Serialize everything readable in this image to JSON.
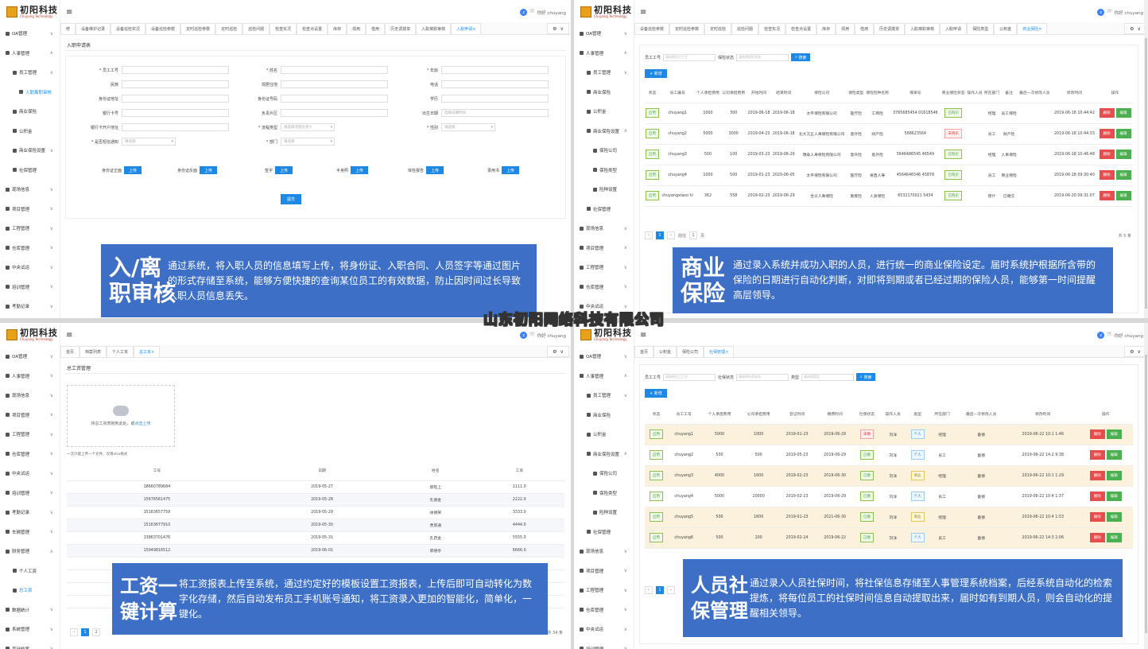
{
  "logo": {
    "cn": "初阳科技",
    "en": "Chuyang Technology"
  },
  "user": {
    "greeting": "你好 chuyang",
    "badge": "z"
  },
  "watermark": "山东初阳网络科技有限公司",
  "q1": {
    "menu": [
      {
        "label": "OA管理",
        "chev": "∨"
      },
      {
        "label": "人事管理",
        "chev": "∧"
      },
      {
        "label": "员工管理",
        "chev": "∧",
        "level": 1
      },
      {
        "label": "入职离职审核",
        "level": 2,
        "active": true
      },
      {
        "label": "商业保险",
        "level": 1
      },
      {
        "label": "公积金",
        "level": 1
      },
      {
        "label": "商业保险设置",
        "chev": "∨",
        "level": 1
      },
      {
        "label": "社保管理",
        "level": 1
      },
      {
        "label": "现场信息",
        "chev": "∨"
      },
      {
        "label": "项目管理",
        "chev": "∨"
      },
      {
        "label": "工程管理",
        "chev": "∨"
      },
      {
        "label": "仓库管理",
        "chev": "∨"
      },
      {
        "label": "中央试运",
        "chev": "∨"
      },
      {
        "label": "培训管理",
        "chev": "∨"
      },
      {
        "label": "考勤记录",
        "chev": "∨"
      },
      {
        "label": "车辆管理",
        "chev": "∨"
      }
    ],
    "tabs": [
      "修",
      "设备维护记录",
      "设备巡检实况",
      "设备巡检参数",
      "定时巡检参数",
      "定时巡检",
      "巡检问题",
      "检查实况",
      "检查点设置",
      "库存",
      "领用",
      "借用",
      "历史调拨单",
      "入职离职审核",
      "入职申请"
    ],
    "active_tab": "入职申请",
    "page_title": "入职申请表",
    "fields": [
      {
        "label": "* 员工工号",
        "col": 0,
        "row": 0
      },
      {
        "label": "* 姓名",
        "col": 1,
        "row": 0
      },
      {
        "label": "* 年龄",
        "col": 2,
        "row": 0
      },
      {
        "label": "民族",
        "col": 0,
        "row": 1
      },
      {
        "label": "现居住地",
        "col": 1,
        "row": 1
      },
      {
        "label": "电话",
        "col": 2,
        "row": 1
      },
      {
        "label": "身份证地址",
        "col": 0,
        "row": 2
      },
      {
        "label": "身份证号码",
        "col": 1,
        "row": 2
      },
      {
        "label": "学历",
        "col": 2,
        "row": 2
      },
      {
        "label": "银行卡号",
        "col": 0,
        "row": 3
      },
      {
        "label": "负责片区",
        "col": 1,
        "row": 3
      },
      {
        "label": "出生日期",
        "col": 2,
        "row": 3,
        "placeholder": "选择日期时间"
      }
    ],
    "selects": [
      {
        "label": "银行卡开户地址",
        "col": 0,
        "row": 4,
        "type": "input"
      },
      {
        "label": "* 流程类型",
        "col": 1,
        "row": 4,
        "placeholder": "请选择流程负责人"
      },
      {
        "label": "* 性别",
        "col": 2,
        "row": 4,
        "placeholder": "请选择"
      },
      {
        "label": "* 是否短信通知",
        "col": 0,
        "row": 5,
        "placeholder": "请选择"
      },
      {
        "label": "* 部门",
        "col": 1,
        "row": 5,
        "placeholder": "请选择"
      }
    ],
    "uploads": [
      "身份证正面",
      "身份证反面",
      "签字",
      "半身照",
      "体检报告",
      "录用书"
    ],
    "upload_label": "上传",
    "submit_label": "提交",
    "card": {
      "title": "入/离\n职审核",
      "desc": "通过系统，将入职人员的信息填写上传，将身份证、入职合同、人员签字等通过图片的形式存储至系统，能够方便快捷的查询某位员工的有效数据，防止因时间过长导致入职人员信息丢失。"
    }
  },
  "q2": {
    "menu": [
      {
        "label": "OA管理",
        "chev": "∨"
      },
      {
        "label": "人事管理",
        "chev": "∧"
      },
      {
        "label": "员工管理",
        "chev": "∨",
        "level": 1
      },
      {
        "label": "商业保险",
        "level": 1
      },
      {
        "label": "公积金",
        "level": 1
      },
      {
        "label": "商业保险设置",
        "chev": "∧",
        "level": 1
      },
      {
        "label": "保险公司",
        "level": 2
      },
      {
        "label": "保险类型",
        "level": 2
      },
      {
        "label": "险种设置",
        "level": 2
      },
      {
        "label": "社保管理",
        "level": 1
      },
      {
        "label": "现场信息",
        "chev": "∨"
      },
      {
        "label": "项目管理",
        "chev": "∨"
      },
      {
        "label": "工程管理",
        "chev": "∨"
      },
      {
        "label": "仓库管理",
        "chev": "∨"
      },
      {
        "label": "中央试运",
        "chev": "∨"
      },
      {
        "label": "培训管理",
        "chev": "∨"
      }
    ],
    "tabs": [
      "设备巡检参数",
      "定时巡检参数",
      "定时巡检",
      "巡检问题",
      "检查实况",
      "检查点设置",
      "库存",
      "领用",
      "借用",
      "历史调拨单",
      "入职离职审核",
      "入职申请",
      "保险类型",
      "公积金",
      "商业保险"
    ],
    "active_tab": "商业保险",
    "search": {
      "label1": "员工工号",
      "ph1": "请选择员工工号",
      "label2": "保险状态",
      "ph2": "请选择保险状态",
      "btn": "搜索"
    },
    "add_label": "+ 新增",
    "columns": [
      "状态",
      "员工编号",
      "个人承担费用",
      "公司承担费用",
      "开始时间",
      "结束时间",
      "保险公司",
      "保险类型",
      "保险险种名称",
      "保单号",
      "商业保险状态",
      "操作人员",
      "所在部门",
      "备注",
      "最后一次修改人员",
      "修改时间",
      "操作"
    ],
    "rows": [
      {
        "status": "启用",
        "id": "chuyang1",
        "personal": "1000",
        "company": "300",
        "start": "2019-06-18",
        "end": "2019-06-18",
        "insurer": "太平保险有限公司",
        "type": "医疗险",
        "name": "工商险",
        "policy": "3765685454 01618546",
        "state": "已购买",
        "state_kind": "green",
        "operator": "",
        "dept": "经理",
        "note": "员工保险",
        "modifier": "",
        "time": "2019-06-18 10:44:42"
      },
      {
        "status": "启用",
        "id": "chuyang2",
        "personal": "5000",
        "company": "3000",
        "start": "2019-04-23",
        "end": "2019-06-18",
        "insurer": "北大方正人寿保险有限公司",
        "type": "意外险",
        "name": "财产险",
        "policy": "568623564",
        "state": "未购买",
        "state_kind": "red",
        "operator": "",
        "dept": "员工",
        "note": "财产险",
        "modifier": "",
        "time": "2019-06-18 10:44:33"
      },
      {
        "status": "启用",
        "id": "chuyang3",
        "personal": "500",
        "company": "100",
        "start": "2019-03-23",
        "end": "2019-06-29",
        "insurer": "瑞泰人寿保险有限公司",
        "type": "意外险",
        "name": "意外险",
        "policy": "5646486545 46549",
        "state": "已购买",
        "state_kind": "green",
        "operator": "",
        "dept": "经理",
        "note": "人事保险",
        "modifier": "",
        "time": "2019-06-18 10:46:48"
      },
      {
        "status": "启用",
        "id": "chuyang4",
        "personal": "1000",
        "company": "500",
        "start": "2019-01-23",
        "end": "2020-06-05",
        "insurer": "太平保险有限公司",
        "type": "医疗险",
        "name": "将直人寿",
        "policy": "4564646546 45878",
        "state": "已购买",
        "state_kind": "green",
        "operator": "",
        "dept": "员工",
        "note": "商业保险",
        "modifier": "",
        "time": "2019-06-18 09:30:40"
      },
      {
        "status": "启用",
        "id": "chuyangxiaoo hi",
        "personal": "362",
        "company": "558",
        "start": "2019-02-23",
        "end": "2019-06-29",
        "insurer": "合众人寿保险",
        "type": "重疾险",
        "name": "人身保险",
        "policy": "6532170021 5434",
        "state": "已购买",
        "state_kind": "green",
        "operator": "",
        "dept": "保什",
        "note": "已缴交",
        "modifier": "",
        "time": "2019-06-20 09:31:07"
      }
    ],
    "del_label": "删除",
    "edit_label": "编辑",
    "pager": {
      "page": "1",
      "goto": "前往",
      "unit": "页",
      "total": "共 5 条"
    },
    "card": {
      "title": "商业\n保险",
      "desc": "通过录入系统并成功入职的人员，进行统一的商业保险设定。届时系统护根据所含带的保险的日期进行自动化判断，对即将到期或者已经过期的保险人员，能够第一时间提醒高层领导。"
    }
  },
  "q3": {
    "menu": [
      {
        "label": "OA管理",
        "chev": "∨"
      },
      {
        "label": "人事管理",
        "chev": "∨"
      },
      {
        "label": "现场信息",
        "chev": "∨"
      },
      {
        "label": "项目管理",
        "chev": "∨"
      },
      {
        "label": "工程管理",
        "chev": "∨"
      },
      {
        "label": "仓库管理",
        "chev": "∨"
      },
      {
        "label": "中央试运",
        "chev": "∨"
      },
      {
        "label": "培训管理",
        "chev": "∨"
      },
      {
        "label": "考勤记录",
        "chev": "∨"
      },
      {
        "label": "车辆管理",
        "chev": "∨"
      },
      {
        "label": "财务管理",
        "chev": "∧"
      },
      {
        "label": "个人工资",
        "level": 1
      },
      {
        "label": "总工资",
        "level": 1,
        "active": true
      },
      {
        "label": "数据统计",
        "chev": "∨"
      },
      {
        "label": "系统管理",
        "chev": "∨"
      },
      {
        "label": "基础档案",
        "chev": "∨"
      }
    ],
    "tabs": [
      "首页",
      "档案列表",
      "个人工资",
      "总工资"
    ],
    "active_tab": "总工资",
    "page_title": "总工资管理",
    "upload_text": "将总工资表拖到此处，或",
    "upload_link": "点击上传",
    "upload_hint": "一次只能上传一个文件，仅限xlsx格式",
    "columns": [
      "工号",
      "日期",
      "姓名",
      "工资"
    ],
    "rows": [
      {
        "no": "18660789684",
        "date": "2019-05-27",
        "name": "郭旺上",
        "pay": "1111.0"
      },
      {
        "no": "15676561475",
        "date": "2019-05-28",
        "name": "孔德金",
        "pay": "2222.0"
      },
      {
        "no": "15163657759",
        "date": "2019-05-29",
        "name": "徐德荣",
        "pay": "3333.0"
      },
      {
        "no": "15163677910",
        "date": "2019-05-30",
        "name": "贾景通",
        "pay": "4444.0"
      },
      {
        "no": "13863701476",
        "date": "2019-05-31",
        "name": "孔药金",
        "pay": "5555.0"
      },
      {
        "no": "15949816512",
        "date": "2019-06-01",
        "name": "郭德亭",
        "pay": "6666.0"
      }
    ],
    "pager": {
      "p1": "1",
      "p2": "2",
      "total": "共 34 条"
    },
    "card": {
      "title": "工资一\n键计算",
      "desc": "将工资报表上传至系统，通过约定好的模板设置工资报表，上传后即可自动转化为数字化存储，然后自动发布员工手机账号通知，将工资录入更加的智能化，简单化，一键化。"
    }
  },
  "q4": {
    "menu": [
      {
        "label": "OA管理",
        "chev": "∨"
      },
      {
        "label": "人事管理",
        "chev": "∧"
      },
      {
        "label": "员工管理",
        "chev": "∨",
        "level": 1
      },
      {
        "label": "商业保险",
        "level": 1
      },
      {
        "label": "公积金",
        "level": 1
      },
      {
        "label": "商业保险设置",
        "chev": "∧",
        "level": 1
      },
      {
        "label": "保险公司",
        "level": 2
      },
      {
        "label": "保险类型",
        "level": 2
      },
      {
        "label": "险种设置",
        "level": 2
      },
      {
        "label": "社保管理",
        "level": 1
      },
      {
        "label": "现场信息",
        "chev": "∨"
      },
      {
        "label": "项目管理",
        "chev": "∨"
      },
      {
        "label": "工程管理",
        "chev": "∨"
      },
      {
        "label": "仓库管理",
        "chev": "∨"
      },
      {
        "label": "中央试运",
        "chev": "∨"
      },
      {
        "label": "培训管理",
        "chev": "∨"
      }
    ],
    "tabs": [
      "首页",
      "公积金",
      "保险公司",
      "社保管理"
    ],
    "active_tab": "社保管理",
    "search": {
      "label1": "员工工号",
      "ph1": "请选择员工工号",
      "label2": "社保状态",
      "ph2": "请选择社保状态",
      "label3": "类型",
      "ph3": "请选择类型",
      "btn": "搜索"
    },
    "add_label": "+ 新增",
    "columns": [
      "状态",
      "员工工号",
      "个人承担费用",
      "公司承担费用",
      "登记时间",
      "缴费时间",
      "社保状态",
      "操作人员",
      "类型",
      "所在部门",
      "最后一次修改人员",
      "修改时间",
      "操作"
    ],
    "rows": [
      {
        "status": "启用",
        "id": "chuyang1",
        "personal": "5000",
        "company": "1000",
        "reg": "2019-01-23",
        "pay": "2019-06-29",
        "state": "未缴",
        "state_kind": "red",
        "operator": "刘洋",
        "type": "个人",
        "type_kind": "blue",
        "dept": "经理",
        "modifier": "童德",
        "time": "2019-06-22 10:1 1:46",
        "alt": true
      },
      {
        "status": "启用",
        "id": "chuyang2",
        "personal": "500",
        "company": "500",
        "reg": "2019-05-23",
        "pay": "2019-06-29",
        "state": "已缴",
        "state_kind": "green",
        "operator": "刘洋",
        "type": "个人",
        "type_kind": "blue",
        "dept": "员工",
        "modifier": "童德",
        "time": "2019-06-22 14:2 9:38",
        "alt": false
      },
      {
        "status": "启用",
        "id": "chuyang3",
        "personal": "4000",
        "company": "1600",
        "reg": "2019-02-23",
        "pay": "2019-06-30",
        "state": "已缴",
        "state_kind": "green",
        "operator": "刘洋",
        "type": "商业",
        "type_kind": "yellow",
        "dept": "经理",
        "modifier": "童德",
        "time": "2019-06-22 10:1 1:29",
        "alt": true
      },
      {
        "status": "启用",
        "id": "chuyang4",
        "personal": "5000",
        "company": "20000",
        "reg": "2019-02-23",
        "pay": "2019-06-29",
        "state": "已缴",
        "state_kind": "green",
        "operator": "刘洋",
        "type": "个人",
        "type_kind": "blue",
        "dept": "员工",
        "modifier": "童德",
        "time": "2019-06-22 10:4 1:37",
        "alt": false
      },
      {
        "status": "启用",
        "id": "chuyang5",
        "personal": "500",
        "company": "1600",
        "reg": "2019-01-23",
        "pay": "2021-06-30",
        "state": "已缴",
        "state_kind": "green",
        "operator": "刘洋",
        "type": "商业",
        "type_kind": "yellow",
        "dept": "经理",
        "modifier": "童德",
        "time": "2019-06-22 10:4 1:53",
        "alt": true
      },
      {
        "status": "启用",
        "id": "chuyang6",
        "personal": "500",
        "company": "200",
        "reg": "2019-02-24",
        "pay": "2019-06-22",
        "state": "已缴",
        "state_kind": "green",
        "operator": "刘洋",
        "type": "个人",
        "type_kind": "blue",
        "dept": "员工",
        "modifier": "童德",
        "time": "2019-06-22 14:3 2:06",
        "alt": true
      }
    ],
    "del_label": "删除",
    "edit_label": "编辑",
    "pager": {
      "page": "1"
    },
    "card": {
      "title": "人员社\n保管理",
      "desc": "通过录入人员社保时间，将社保信息存储至人事管理系统档案，后经系统自动化的检索提炼，将每位员工的社保时间信息自动提取出来，届时如有到期人员，则会自动化的提醒相关领导。"
    }
  }
}
